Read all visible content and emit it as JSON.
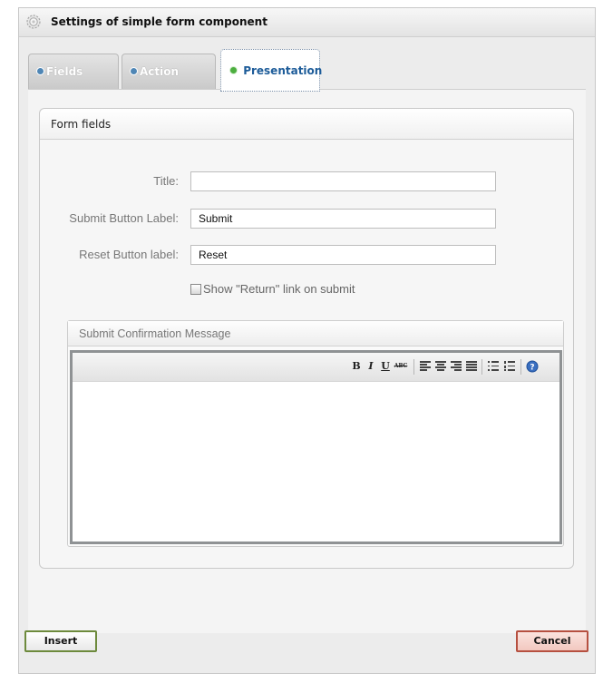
{
  "window": {
    "title": "Settings of simple form component"
  },
  "tabs": [
    {
      "label": "Fields",
      "active": false
    },
    {
      "label": "Action",
      "active": false
    },
    {
      "label": "Presentation",
      "active": true
    }
  ],
  "form_panel": {
    "title": "Form fields",
    "fields": [
      {
        "label": "Title:",
        "value": ""
      },
      {
        "label": "Submit Button Label:",
        "value": "Submit"
      },
      {
        "label": "Reset Button label:",
        "value": "Reset"
      }
    ],
    "checkbox": {
      "label": "Show \"Return\" link on submit",
      "checked": false
    }
  },
  "message_panel": {
    "title": "Submit Confirmation Message",
    "toolbar": {
      "bold": "B",
      "italic": "I",
      "underline": "U",
      "strikethrough": "ABC"
    },
    "content": ""
  },
  "footer": {
    "insert_label": "Insert",
    "cancel_label": "Cancel"
  },
  "colors": {
    "active_tab_text": "#1d5c99",
    "insert_border": "#6d8a3c",
    "cancel_border": "#b65040"
  },
  "icons": [
    "gear-icon",
    "tab-dot-icon",
    "bold-icon",
    "italic-icon",
    "underline-icon",
    "strikethrough-icon",
    "align-left-icon",
    "align-center-icon",
    "align-right-icon",
    "align-justify-icon",
    "bullet-list-icon",
    "numbered-list-icon",
    "help-icon"
  ]
}
